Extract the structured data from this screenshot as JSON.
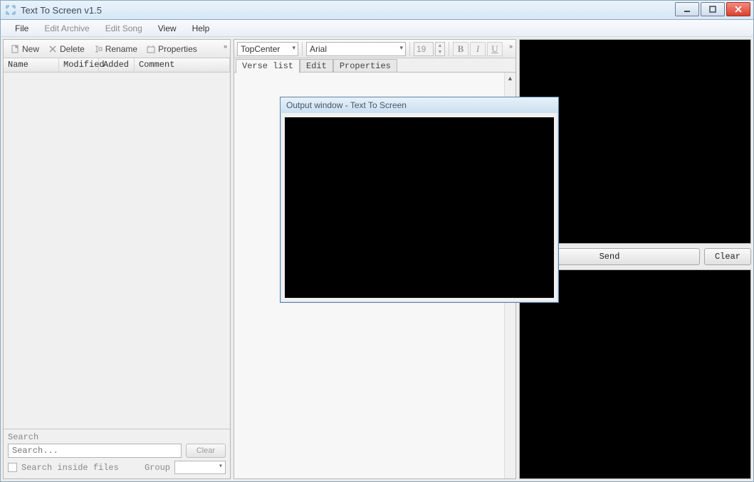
{
  "window": {
    "title": "Text To Screen v1.5"
  },
  "menubar": {
    "file": "File",
    "edit_archive": "Edit Archive",
    "edit_song": "Edit Song",
    "view": "View",
    "help": "Help"
  },
  "left": {
    "toolbar": {
      "new": "New",
      "delete": "Delete",
      "rename": "Rename",
      "properties": "Properties"
    },
    "columns": {
      "name": "Name",
      "modified": "Modified",
      "added": "Added",
      "comment": "Comment"
    },
    "search": {
      "section_label": "Search",
      "placeholder": "Search...",
      "clear": "Clear",
      "inside_label": "Search inside files",
      "group_label": "Group"
    }
  },
  "mid": {
    "align_dd": "TopCenter",
    "font_dd": "Arial",
    "font_size": "19",
    "tabs": {
      "verse": "Verse list",
      "edit": "Edit",
      "properties": "Properties"
    }
  },
  "right": {
    "send": "Send",
    "clear": "Clear"
  },
  "output_window": {
    "title": "Output window - Text To Screen"
  }
}
